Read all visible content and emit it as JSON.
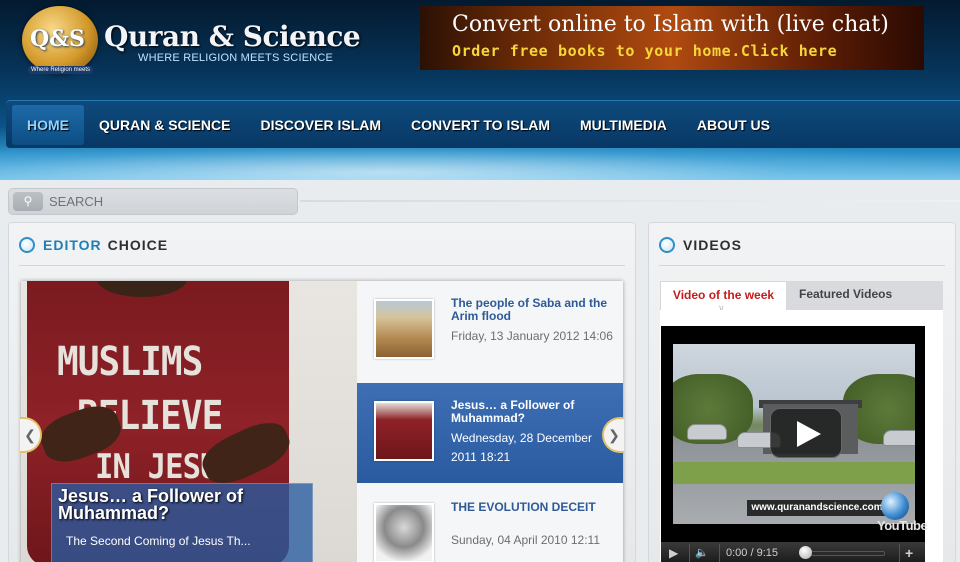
{
  "site": {
    "logo_badge": "Q&S",
    "logo_badge_sub": "Where Religion meets",
    "title": "Quran & Science",
    "tagline": "WHERE RELIGION MEETS SCIENCE"
  },
  "banner": {
    "line1": "Convert online to Islam with (live chat)",
    "line2": "Order free books to your home.Click here"
  },
  "nav": {
    "items": [
      {
        "label": "HOME",
        "active": true
      },
      {
        "label": "QURAN & SCIENCE",
        "active": false
      },
      {
        "label": "DISCOVER ISLAM",
        "active": false
      },
      {
        "label": "CONVERT TO ISLAM",
        "active": false
      },
      {
        "label": "MULTIMEDIA",
        "active": false
      },
      {
        "label": "ABOUT US",
        "active": false
      }
    ]
  },
  "search": {
    "placeholder": "SEARCH",
    "icon": "search-icon"
  },
  "editor": {
    "heading_accent": "EDITOR",
    "heading_main": "CHOICE",
    "featured": {
      "title": "Jesus… a Follower of Muhammad?",
      "excerpt": "The Second Coming of Jesus Th...",
      "shirt_lines": [
        "MUSLIMS",
        "BELIEVE",
        "IN JESUS"
      ]
    },
    "items": [
      {
        "title": "The people of Saba and the Arim flood",
        "date": "Friday, 13 January 2012 14:06",
        "active": false
      },
      {
        "title": "Jesus… a Follower of Muhammad?",
        "date": "Wednesday, 28 December 2011 18:21",
        "active": true
      },
      {
        "title": "THE EVOLUTION DECEIT",
        "date": "Sunday, 04 April 2010 12:11",
        "active": false
      }
    ],
    "prev_icon": "chevron-left-icon",
    "next_icon": "chevron-right-icon"
  },
  "videos": {
    "heading": "VIDEOS",
    "tabs": [
      {
        "label": "Video of the week",
        "active": true
      },
      {
        "label": "Featured Videos",
        "active": false
      }
    ],
    "player": {
      "watermark": "www.quranandscience.com",
      "brand": "YouTube",
      "time": "0:00 / 9:15"
    },
    "colors": {
      "active_tab": "#c31c1c",
      "accent": "#1d7fb8"
    }
  }
}
